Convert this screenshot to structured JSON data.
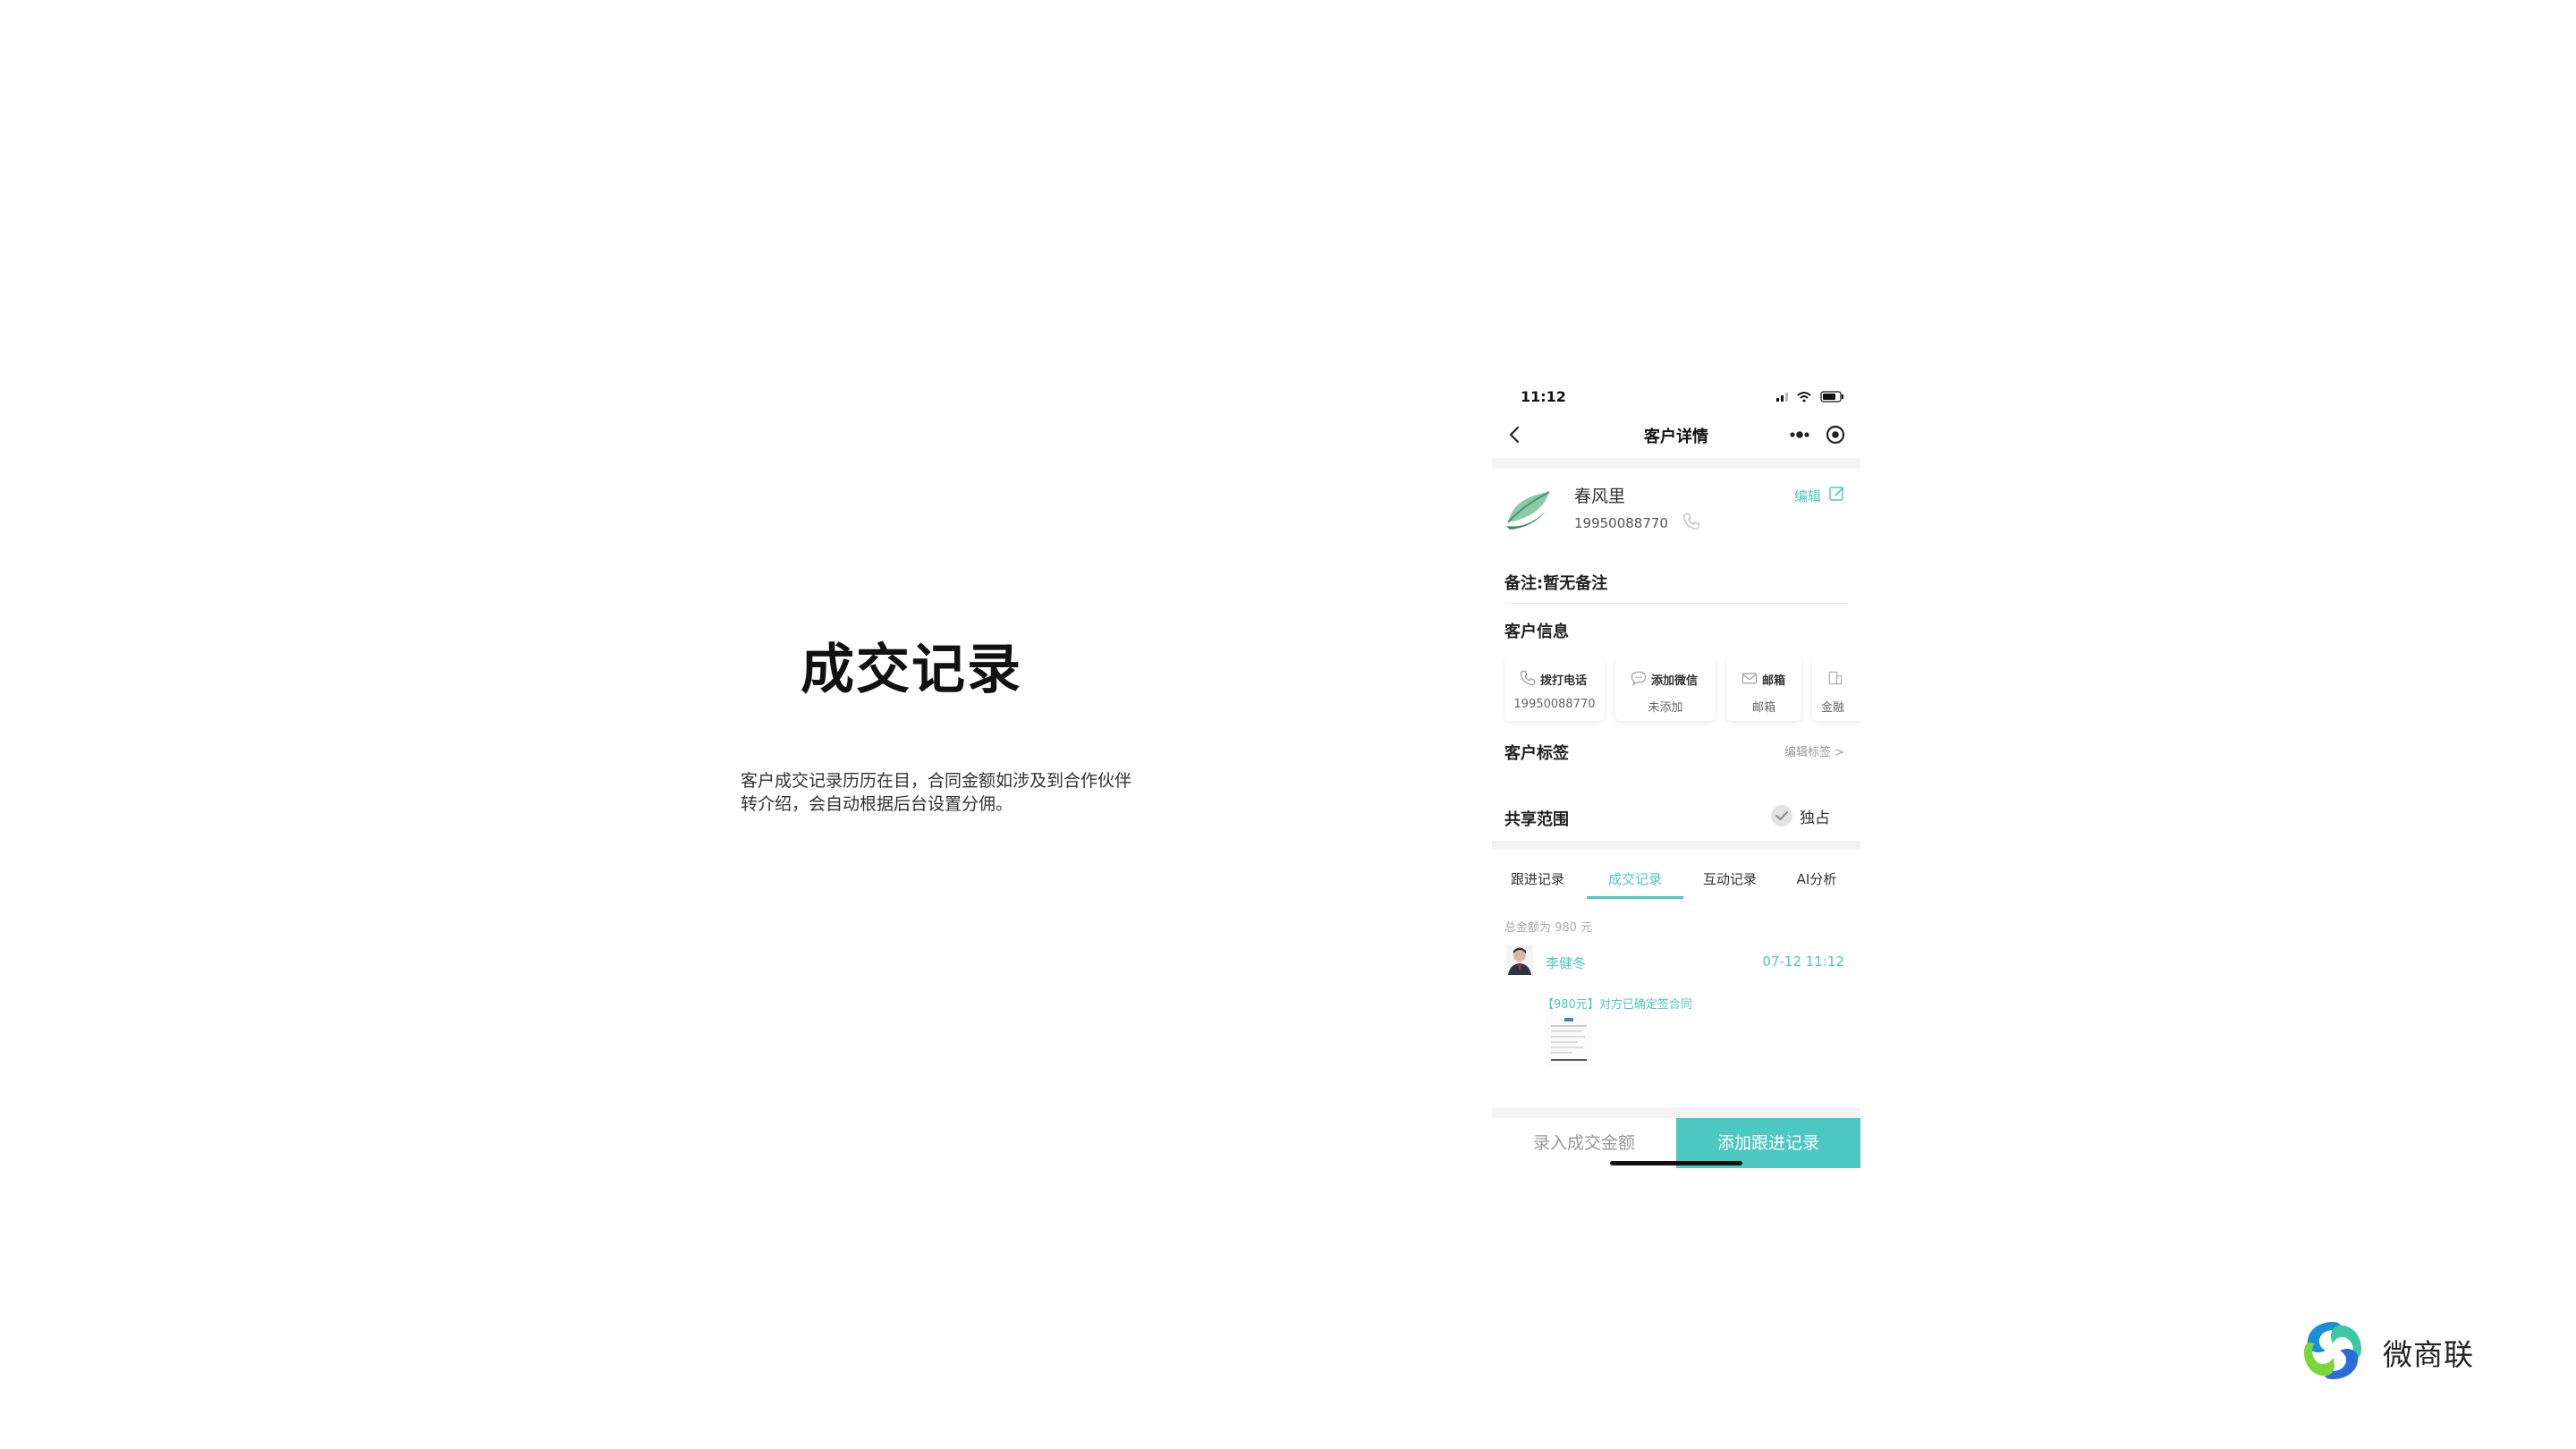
{
  "slide": {
    "title": "成交记录",
    "description": "客户成交记录历历在目，合同金额如涉及到合作伙伴转介绍，会自动根据后台设置分佣。"
  },
  "status_bar": {
    "time": "11:12"
  },
  "nav": {
    "title": "客户详情"
  },
  "customer": {
    "name": "春风里",
    "phone": "19950088770",
    "edit_label": "编辑",
    "remark": "备注:暂无备注"
  },
  "customer_info": {
    "label": "客户信息",
    "cards": [
      {
        "label": "拨打电话",
        "value": "19950088770",
        "icon": "phone-icon"
      },
      {
        "label": "添加微信",
        "value": "未添加",
        "icon": "chat-icon"
      },
      {
        "label": "邮箱",
        "value": "邮箱",
        "icon": "mail-icon"
      },
      {
        "label": "",
        "value": "金融",
        "icon": "building-icon"
      }
    ]
  },
  "tags": {
    "label": "客户标签",
    "edit_label": "编辑标签 >"
  },
  "share": {
    "label": "共享范围",
    "value": "独占"
  },
  "tabs": [
    {
      "label": "跟进记录",
      "active": false
    },
    {
      "label": "成交记录",
      "active": true
    },
    {
      "label": "互动记录",
      "active": false
    },
    {
      "label": "AI分析",
      "active": false
    }
  ],
  "deals": {
    "total": "总金额为 980 元",
    "records": [
      {
        "user": "李健冬",
        "time": "07-12 11:12",
        "text": "【980元】对方已确定签合同"
      }
    ]
  },
  "bottom": {
    "amount_button": "录入成交金额",
    "follow_button": "添加跟进记录"
  },
  "brand": {
    "name": "微商联"
  },
  "colors": {
    "accent": "#4cc7c2"
  }
}
